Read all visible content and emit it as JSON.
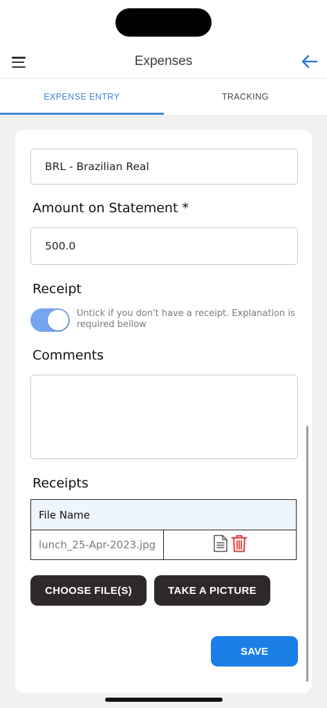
{
  "header": {
    "title": "Expenses"
  },
  "tabs": [
    {
      "label": "EXPENSE ENTRY",
      "active": true
    },
    {
      "label": "TRACKING",
      "active": false
    }
  ],
  "form": {
    "currency_value": "BRL - Brazilian Real",
    "amount_label": "Amount on Statement *",
    "amount_value": "500.0",
    "receipt_label": "Receipt",
    "receipt_toggle_on": true,
    "receipt_hint": "Untick if you don't have a receipt. Explanation is required bellow",
    "comments_label": "Comments",
    "comments_value": ""
  },
  "receipts": {
    "label": "Receipts",
    "column_header": "File Name",
    "files": [
      {
        "name": "lunch_25-Apr-2023.jpg"
      }
    ]
  },
  "buttons": {
    "choose_files": "CHOOSE FILE(S)",
    "take_picture": "TAKE A PICTURE",
    "save": "SAVE"
  },
  "colors": {
    "accent": "#3e84d6",
    "save": "#1b7fe8",
    "toggle": "#77a4ee",
    "delete": "#e53935"
  }
}
